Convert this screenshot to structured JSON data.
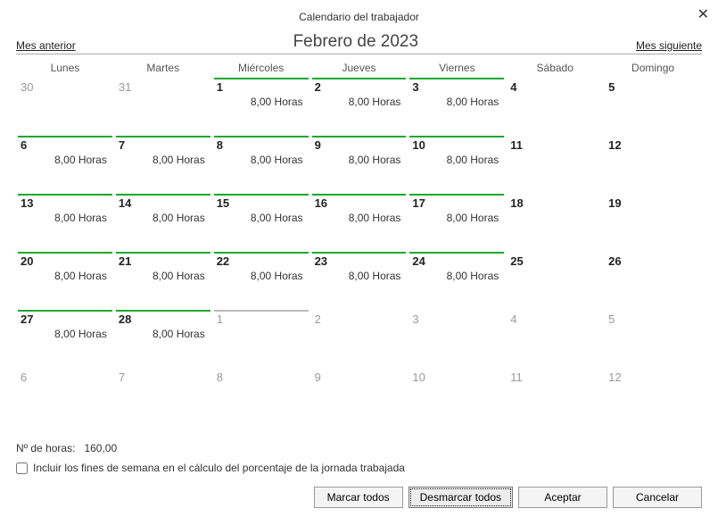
{
  "titlebar": "Calendario del trabajador",
  "close_glyph": "✕",
  "nav": {
    "prev": "Mes anterior",
    "title": "Febrero de 2023",
    "next": "Mes siguiente"
  },
  "weekdays": [
    "Lunes",
    "Martes",
    "Miércoles",
    "Jueves",
    "Viernes",
    "Sábado",
    "Domingo"
  ],
  "hours_text": "8,00 Horas",
  "weeks": [
    [
      {
        "n": "30",
        "dim": true,
        "line": "none",
        "hours": false
      },
      {
        "n": "31",
        "dim": true,
        "line": "none",
        "hours": false
      },
      {
        "n": "1",
        "dim": false,
        "line": "green",
        "hours": true
      },
      {
        "n": "2",
        "dim": false,
        "line": "green",
        "hours": true
      },
      {
        "n": "3",
        "dim": false,
        "line": "green",
        "hours": true
      },
      {
        "n": "4",
        "dim": false,
        "line": "none",
        "hours": false
      },
      {
        "n": "5",
        "dim": false,
        "line": "none",
        "hours": false
      }
    ],
    [
      {
        "n": "6",
        "dim": false,
        "line": "green",
        "hours": true
      },
      {
        "n": "7",
        "dim": false,
        "line": "green",
        "hours": true
      },
      {
        "n": "8",
        "dim": false,
        "line": "green",
        "hours": true
      },
      {
        "n": "9",
        "dim": false,
        "line": "green",
        "hours": true
      },
      {
        "n": "10",
        "dim": false,
        "line": "green",
        "hours": true
      },
      {
        "n": "11",
        "dim": false,
        "line": "none",
        "hours": false
      },
      {
        "n": "12",
        "dim": false,
        "line": "none",
        "hours": false
      }
    ],
    [
      {
        "n": "13",
        "dim": false,
        "line": "green",
        "hours": true
      },
      {
        "n": "14",
        "dim": false,
        "line": "green",
        "hours": true
      },
      {
        "n": "15",
        "dim": false,
        "line": "green",
        "hours": true
      },
      {
        "n": "16",
        "dim": false,
        "line": "green",
        "hours": true
      },
      {
        "n": "17",
        "dim": false,
        "line": "green",
        "hours": true
      },
      {
        "n": "18",
        "dim": false,
        "line": "none",
        "hours": false
      },
      {
        "n": "19",
        "dim": false,
        "line": "none",
        "hours": false
      }
    ],
    [
      {
        "n": "20",
        "dim": false,
        "line": "green",
        "hours": true
      },
      {
        "n": "21",
        "dim": false,
        "line": "green",
        "hours": true
      },
      {
        "n": "22",
        "dim": false,
        "line": "green",
        "hours": true
      },
      {
        "n": "23",
        "dim": false,
        "line": "green",
        "hours": true
      },
      {
        "n": "24",
        "dim": false,
        "line": "green",
        "hours": true
      },
      {
        "n": "25",
        "dim": false,
        "line": "none",
        "hours": false
      },
      {
        "n": "26",
        "dim": false,
        "line": "none",
        "hours": false
      }
    ],
    [
      {
        "n": "27",
        "dim": false,
        "line": "green",
        "hours": true
      },
      {
        "n": "28",
        "dim": false,
        "line": "green",
        "hours": true
      },
      {
        "n": "1",
        "dim": true,
        "line": "gray",
        "hours": false
      },
      {
        "n": "2",
        "dim": true,
        "line": "none",
        "hours": false
      },
      {
        "n": "3",
        "dim": true,
        "line": "none",
        "hours": false
      },
      {
        "n": "4",
        "dim": true,
        "line": "none",
        "hours": false
      },
      {
        "n": "5",
        "dim": true,
        "line": "none",
        "hours": false
      }
    ],
    [
      {
        "n": "6",
        "dim": true,
        "line": "none",
        "hours": false
      },
      {
        "n": "7",
        "dim": true,
        "line": "none",
        "hours": false
      },
      {
        "n": "8",
        "dim": true,
        "line": "none",
        "hours": false
      },
      {
        "n": "9",
        "dim": true,
        "line": "none",
        "hours": false
      },
      {
        "n": "10",
        "dim": true,
        "line": "none",
        "hours": false
      },
      {
        "n": "11",
        "dim": true,
        "line": "none",
        "hours": false
      },
      {
        "n": "12",
        "dim": true,
        "line": "none",
        "hours": false
      }
    ]
  ],
  "summary": {
    "label": "Nº de horas:",
    "value": "160,00"
  },
  "checkbox_label": "Incluir los fines de semana en el cálculo del porcentaje de la jornada trabajada",
  "buttons": {
    "mark_all": "Marcar todos",
    "unmark_all": "Desmarcar todos",
    "accept": "Aceptar",
    "cancel": "Cancelar"
  }
}
